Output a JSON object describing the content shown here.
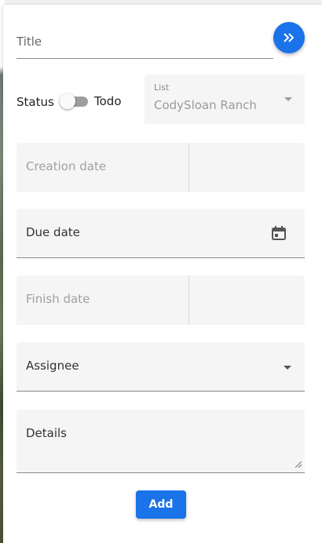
{
  "form": {
    "title_placeholder": "Title",
    "status_label": "Status",
    "status_value_label": "Todo",
    "list": {
      "label": "List",
      "value": "CodySloan Ranch"
    },
    "creation_date_label": "Creation date",
    "due_date_label": "Due date",
    "finish_date_label": "Finish date",
    "assignee_label": "Assignee",
    "details_label": "Details",
    "add_label": "Add"
  },
  "icons": {
    "fab": "double-chevron-right-icon",
    "due_date": "calendar-icon",
    "assignee": "dropdown-arrow-icon",
    "list": "dropdown-arrow-icon"
  },
  "colors": {
    "accent": "#1a73e8"
  }
}
